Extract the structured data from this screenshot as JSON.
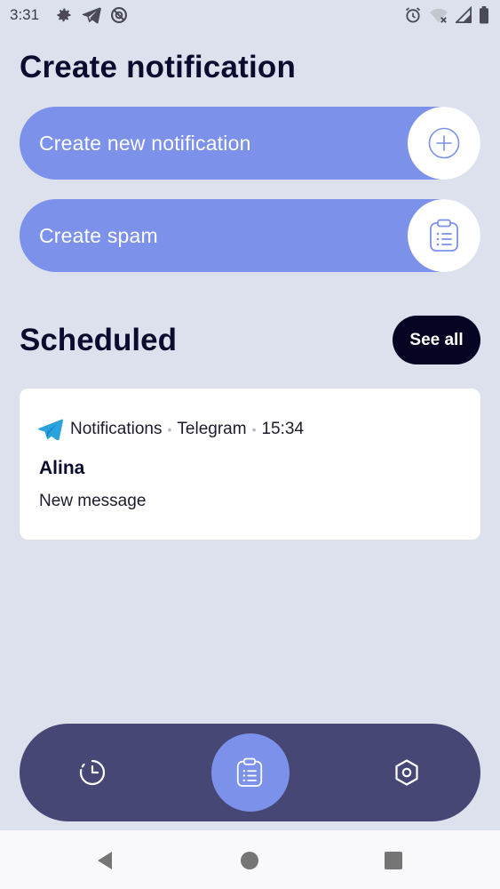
{
  "status_bar": {
    "time": "3:31",
    "left_icons": [
      "gear-icon",
      "telegram-icon",
      "no-disturb-icon"
    ],
    "right_icons": [
      "alarm-icon",
      "wifi-off-icon",
      "signal-icon",
      "battery-icon"
    ]
  },
  "header": {
    "title": "Create notification"
  },
  "actions": {
    "new_notification_label": "Create new notification",
    "new_notification_icon": "plus-circle-icon",
    "spam_label": "Create spam",
    "spam_icon": "clipboard-list-icon"
  },
  "scheduled": {
    "title": "Scheduled",
    "see_all_label": "See all",
    "items": [
      {
        "app": "Notifications",
        "source": "Telegram",
        "time": "15:34",
        "sender": "Alina",
        "message": "New message",
        "icon": "telegram-icon"
      }
    ]
  },
  "bottom_nav": {
    "items": [
      {
        "id": "history",
        "icon": "clock-icon",
        "active": false
      },
      {
        "id": "spam",
        "icon": "clipboard-list-icon",
        "active": true
      },
      {
        "id": "settings",
        "icon": "hexagon-settings-icon",
        "active": false
      }
    ]
  },
  "system_nav": {
    "buttons": [
      "back-triangle-icon",
      "home-circle-icon",
      "recents-square-icon"
    ]
  },
  "colors": {
    "background": "#dde1ee",
    "accent": "#7b91ea",
    "nav_bar": "#464775",
    "dark_button": "#050523",
    "title_text": "#0b0b2e",
    "telegram_blue": "#2aa3df"
  }
}
